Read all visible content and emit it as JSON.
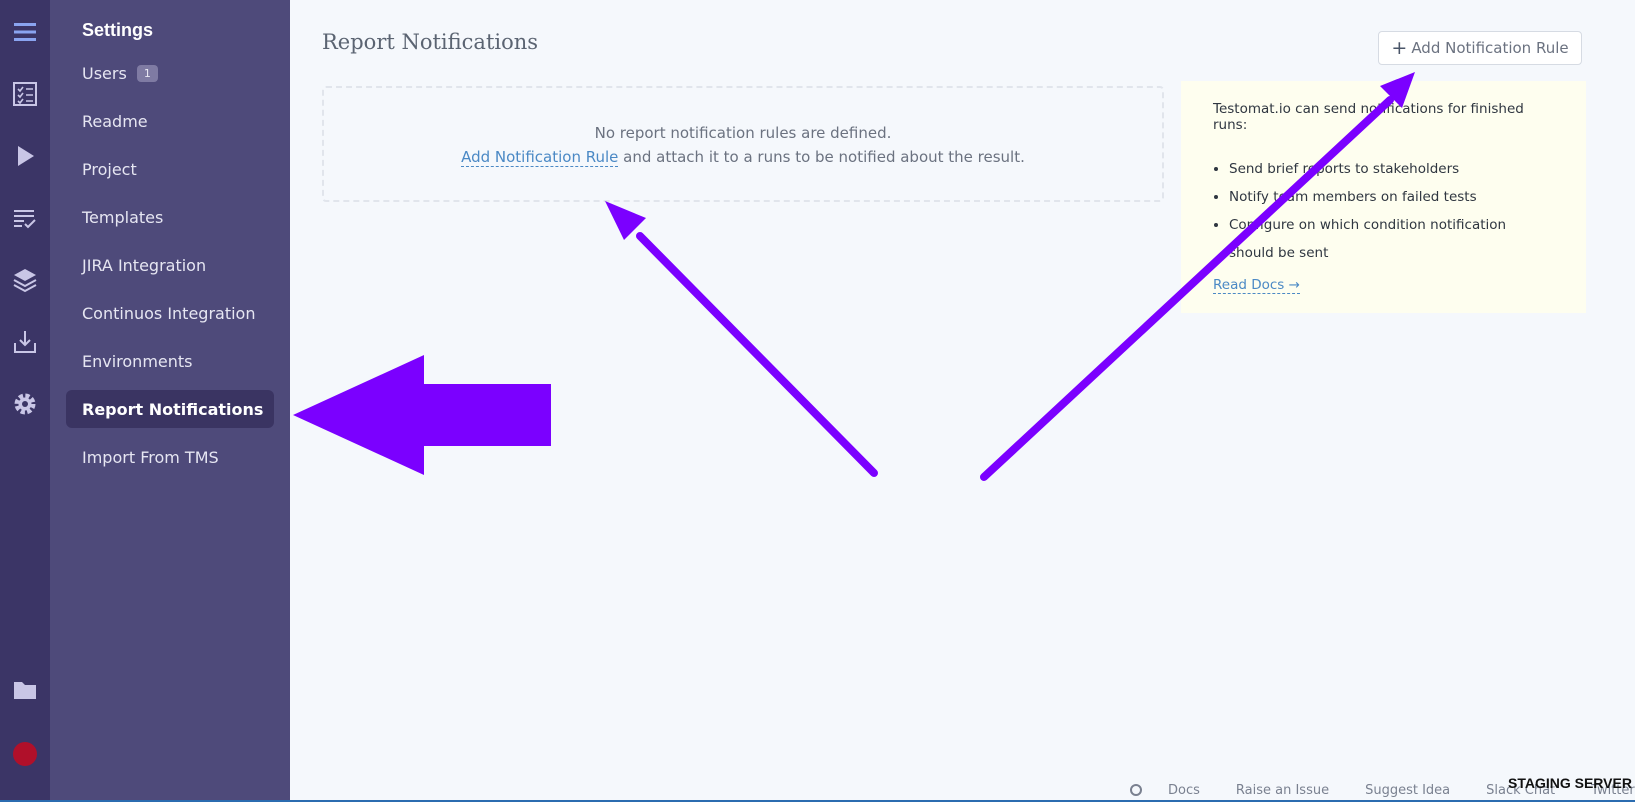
{
  "rail": {
    "icons": [
      "menu-icon",
      "checklist-icon",
      "play-icon",
      "runs-icon",
      "layers-icon",
      "import-icon",
      "gear-icon",
      "folder-icon",
      "avatar"
    ]
  },
  "sidebar": {
    "title": "Settings",
    "items": [
      {
        "label": "Users",
        "badge": "1"
      },
      {
        "label": "Readme"
      },
      {
        "label": "Project"
      },
      {
        "label": "Templates"
      },
      {
        "label": "JIRA Integration"
      },
      {
        "label": "Continuos Integration"
      },
      {
        "label": "Environments"
      },
      {
        "label": "Report Notifications",
        "active": true
      },
      {
        "label": "Import From TMS"
      }
    ]
  },
  "main": {
    "title": "Report Notifications",
    "add_button": "Add Notification Rule",
    "empty": {
      "line1": "No report notification rules are defined.",
      "link": "Add Notification Rule",
      "line2_rest": "and attach it to a runs to be notified about the result."
    },
    "info": {
      "intro": "Testomat.io can send notifications for finished runs:",
      "bullets": [
        "Send brief reports to stakeholders",
        "Notify team members on failed tests",
        "Configure on which condition notification should be sent"
      ],
      "read_docs": "Read Docs →"
    }
  },
  "footer": {
    "links": [
      "Docs",
      "Raise an Issue",
      "Suggest Idea",
      "Slack Chat",
      "Twitter"
    ],
    "staging": "STAGING SERVER"
  },
  "colors": {
    "rail": "#3b3566",
    "sidebar": "#4e4a7a",
    "active_item": "#3a3462",
    "accent_link": "#4b89c5",
    "annotation": "#7b00ff",
    "info_bg": "#fefeef"
  }
}
